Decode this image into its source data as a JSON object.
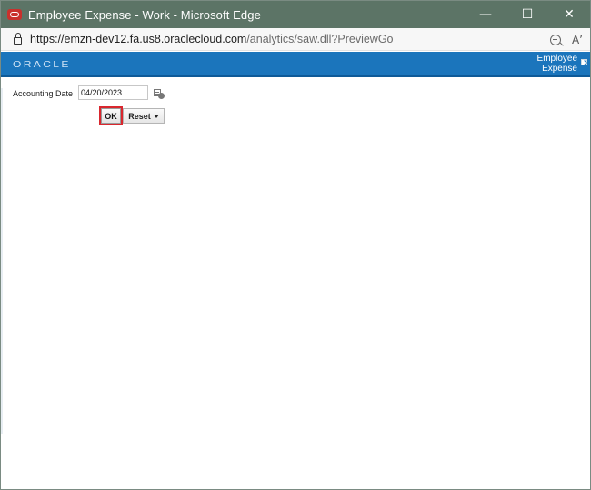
{
  "window": {
    "title": "Employee Expense - Work - Microsoft Edge",
    "minimize": "—",
    "maximize": "☐",
    "close": "✕"
  },
  "address": {
    "url_main": "https://emzn-dev12.fa.us8.oraclecloud.com",
    "url_path": "/analytics/saw.dll?PreviewGo",
    "read_aloud": "A’"
  },
  "oracle": {
    "logo": "ORACLE",
    "report_line1": "Employee",
    "report_line2": "Expense"
  },
  "prompt": {
    "accounting_date_label": "Accounting Date",
    "accounting_date_value": "04/20/2023",
    "ok_label": "OK",
    "reset_label": "Reset"
  },
  "colors": {
    "titlebar": "#5c7466",
    "oracle_bar": "#1b75bc",
    "highlight": "#d9272e"
  }
}
